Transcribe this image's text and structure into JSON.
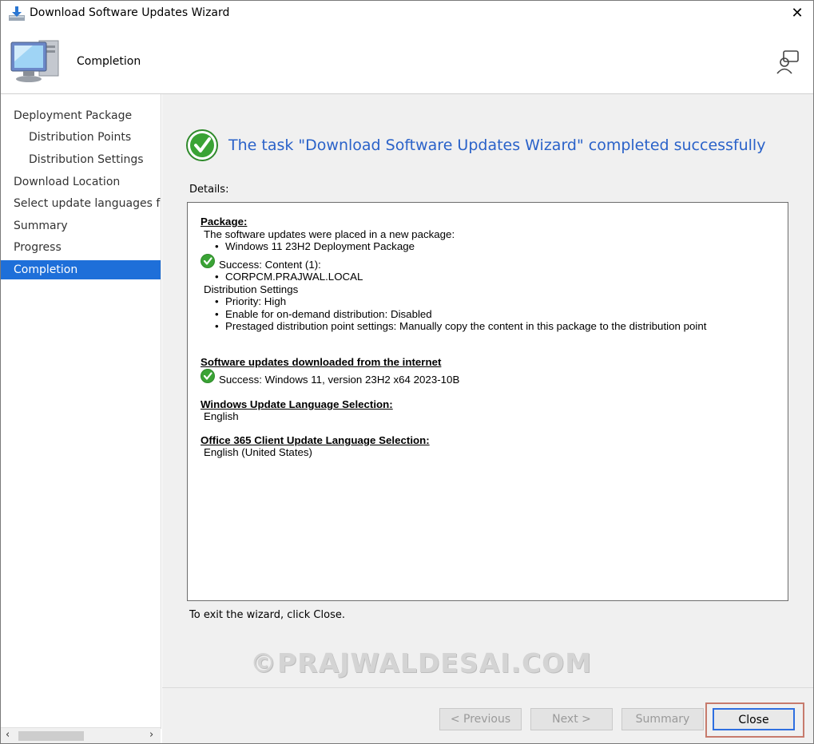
{
  "window": {
    "title": "Download Software Updates Wizard"
  },
  "header": {
    "title": "Completion"
  },
  "nav": {
    "items": [
      {
        "label": "Deployment Package",
        "sub": false,
        "active": false
      },
      {
        "label": "Distribution Points",
        "sub": true,
        "active": false
      },
      {
        "label": "Distribution Settings",
        "sub": true,
        "active": false
      },
      {
        "label": "Download Location",
        "sub": false,
        "active": false
      },
      {
        "label": "Select update languages for",
        "sub": false,
        "active": false
      },
      {
        "label": "Summary",
        "sub": false,
        "active": false
      },
      {
        "label": "Progress",
        "sub": false,
        "active": false
      },
      {
        "label": "Completion",
        "sub": false,
        "active": true
      }
    ]
  },
  "main": {
    "success_message": "The task \"Download Software Updates Wizard\" completed successfully",
    "details_label": "Details:",
    "details": {
      "package_heading": "Package:",
      "package_line": "The software updates were placed in a new package:",
      "package_name": "Windows 11 23H2 Deployment Package",
      "content_success": "Success: Content (1):",
      "dp_name": "CORPCM.PRAJWAL.LOCAL",
      "dist_settings": "Distribution Settings",
      "priority": "Priority: High",
      "on_demand": "Enable for on-demand distribution: Disabled",
      "prestaged": "Prestaged distribution point settings: Manually copy the content in this package to the distribution point",
      "downloaded_heading": "Software updates downloaded from the internet",
      "downloaded_success": "Success: Windows 11, version 23H2 x64 2023-10B",
      "wu_lang_heading": "Windows Update Language Selection:",
      "wu_lang_value": "English",
      "o365_lang_heading": "Office 365 Client Update Language Selection:",
      "o365_lang_value": "English (United States)"
    },
    "exit_text": "To exit the wizard, click Close."
  },
  "footer": {
    "previous_label": "< Previous",
    "next_label": "Next >",
    "summary_label": "Summary",
    "close_label": "Close"
  },
  "watermark": "©PRAJWALDESAI.COM",
  "colors": {
    "accent": "#1e6fd9",
    "title_blue": "#2a62c9",
    "success_green": "#3aa335"
  },
  "icons": [
    "download-icon",
    "monitor-icon",
    "help-icon",
    "success-check-icon",
    "close-icon"
  ]
}
